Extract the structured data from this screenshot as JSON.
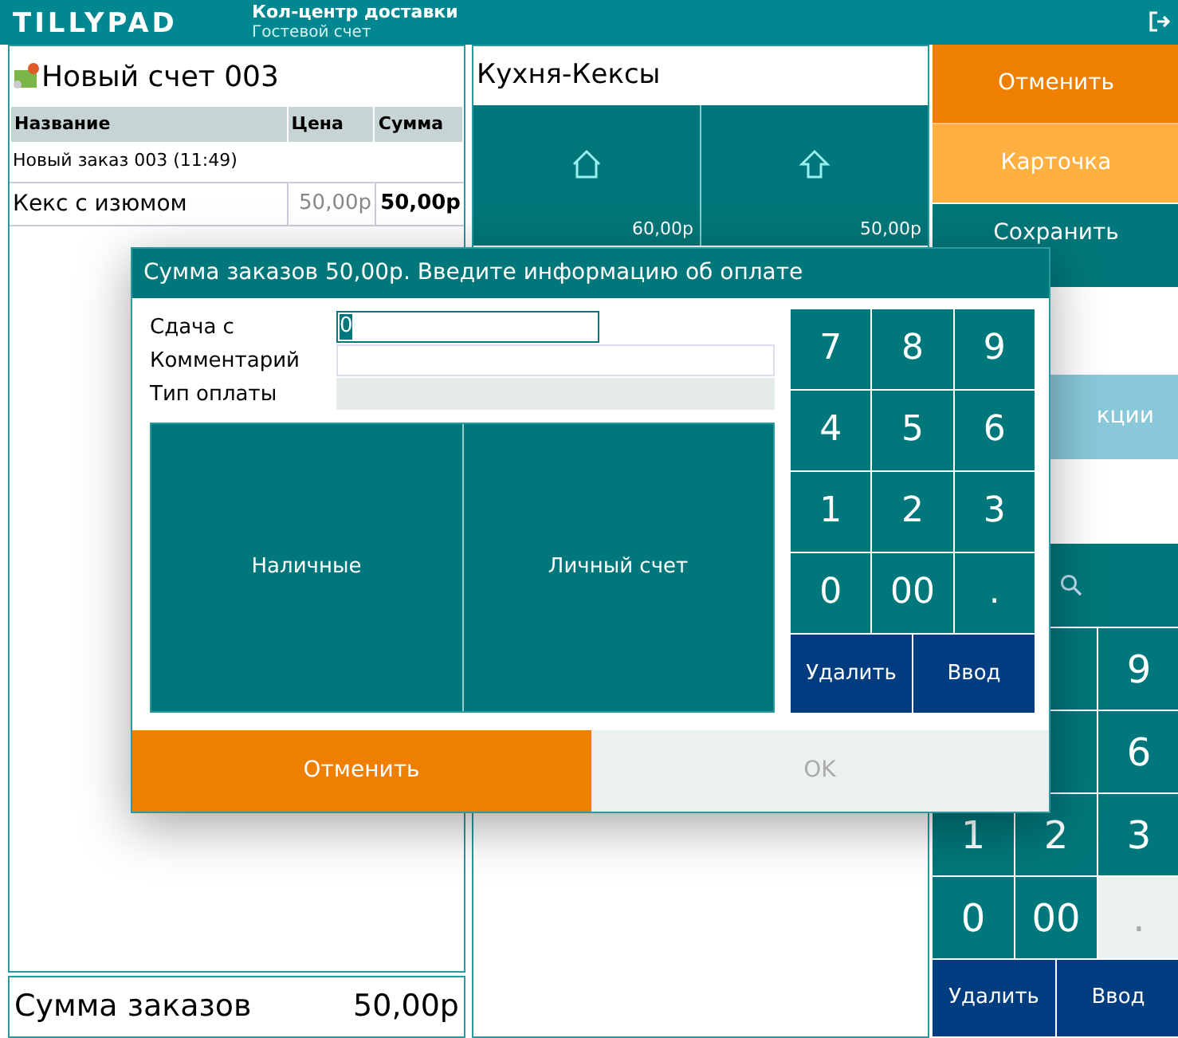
{
  "header": {
    "logo": "TILLYPAD",
    "title": "Кол-центр доставки",
    "subtitle": "Гостевой счет"
  },
  "order": {
    "title": "Новый счет 003",
    "columns": [
      "Название",
      "Цена",
      "Сумма"
    ],
    "group": "Новый заказ 003 (11:49)",
    "items": [
      {
        "name": "Кекс с изюмом",
        "price": "50,00р",
        "sum": "50,00р"
      }
    ],
    "total_label": "Сумма заказов",
    "total_value": "50,00р"
  },
  "menu": {
    "title": "Кухня-Кексы",
    "tiles": [
      {
        "kind": "home",
        "price": "60,00р"
      },
      {
        "kind": "up",
        "price": "50,00р"
      }
    ]
  },
  "actions": [
    {
      "label": "Отменить",
      "kind": "cancel"
    },
    {
      "label": "Карточка",
      "kind": "card"
    },
    {
      "label": "Сохранить",
      "kind": "save"
    },
    {
      "label": "кции",
      "kind": "promo"
    }
  ],
  "side_keypad": {
    "keys": [
      {
        "label": "9",
        "disabled": false
      },
      {
        "label": "6",
        "disabled": false
      },
      {
        "label": "1",
        "disabled": false
      },
      {
        "label": "2",
        "disabled": false
      },
      {
        "label": "3",
        "disabled": false
      },
      {
        "label": "0",
        "disabled": false
      },
      {
        "label": "00",
        "disabled": false
      },
      {
        "label": ".",
        "disabled": true
      }
    ],
    "delete": "Удалить",
    "enter": "Ввод"
  },
  "dialog": {
    "title": "Сумма заказов 50,00р. Введите информацию об оплате",
    "fields": [
      {
        "label": "Сдача с",
        "kind": "input",
        "value": "0",
        "selected": true
      },
      {
        "label": "Комментарий",
        "kind": "input"
      },
      {
        "label": "Тип оплаты",
        "kind": "readonly"
      }
    ],
    "payment_types": [
      "Наличные",
      "Личный счет"
    ],
    "keypad": [
      "7",
      "8",
      "9",
      "4",
      "5",
      "6",
      "1",
      "2",
      "3",
      "0",
      "00",
      "."
    ],
    "delete": "Удалить",
    "enter": "Ввод",
    "buttons": [
      {
        "label": "Отменить",
        "kind": "cancel",
        "disabled": false
      },
      {
        "label": "OK",
        "kind": "ok",
        "disabled": true
      }
    ]
  }
}
